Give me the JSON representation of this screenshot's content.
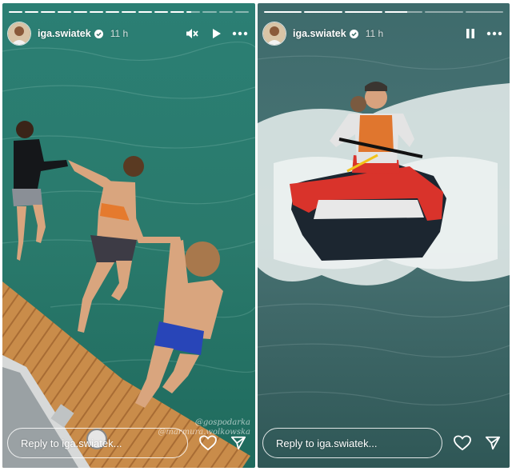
{
  "stories": [
    {
      "username": "iga.swiatek",
      "time": "11 h",
      "reply_placeholder": "Reply to iga.swiatek...",
      "watermark_lines": [
        "@gospodarka",
        "@marmura.wolkowska"
      ],
      "progress": [
        1,
        1,
        1,
        1,
        1,
        1,
        1,
        1,
        1,
        1,
        1,
        0.35,
        0,
        0,
        0
      ],
      "controls": [
        "muted-speaker-icon",
        "play-icon",
        "more-icon"
      ]
    },
    {
      "username": "iga.swiatek",
      "time": "11 h",
      "reply_placeholder": "Reply to iga.swiatek...",
      "progress": [
        1,
        1,
        1,
        0.6,
        0,
        0
      ],
      "controls": [
        "pause-icon",
        "more-icon"
      ]
    }
  ],
  "colors": {
    "left_sea": "#2f7a6e",
    "left_deck": "#c98c4a",
    "right_sea": "#3a6360",
    "jetski": "#d9332b"
  }
}
